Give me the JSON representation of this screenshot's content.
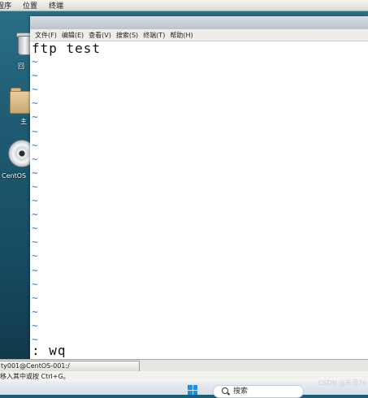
{
  "top_panel": {
    "items": [
      "程序",
      "位置",
      "终端"
    ]
  },
  "desktop": {
    "icons": [
      {
        "label": "回",
        "icon": "trash-icon"
      },
      {
        "label": "主",
        "icon": "home-folder-icon"
      },
      {
        "label": "CentOS",
        "icon": "disc-icon"
      }
    ]
  },
  "menubar": {
    "items": [
      "文件(F)",
      "编辑(E)",
      "查看(V)",
      "搜索(S)",
      "终端(T)",
      "帮助(H)"
    ]
  },
  "editor": {
    "first_line": "ftp test",
    "tilde": "~",
    "tilde_count": 21,
    "command_line": ": wq"
  },
  "taskbar": {
    "task_label": "ty001@CentOS-001:/",
    "status_text": "移入其中或按 Ctrl+G。"
  },
  "windows_taskbar": {
    "search_placeholder": "搜索",
    "watermark": "CSDN @天涯76"
  },
  "colors": {
    "tilde": "#3b7fd0",
    "desktop": "#1d5a71"
  }
}
